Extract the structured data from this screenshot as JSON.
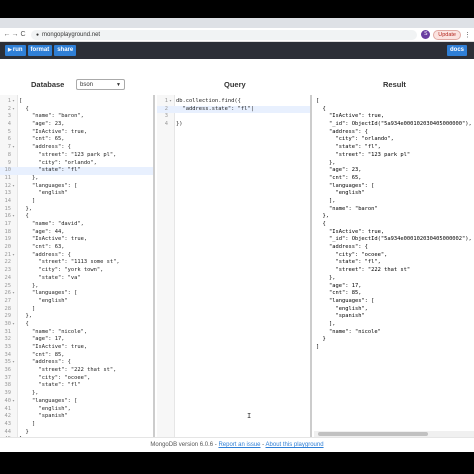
{
  "browser": {
    "url": "mongoplayground.net",
    "avatar_letter": "S",
    "update_label": "Update",
    "back_icon": "←",
    "forward_icon": "→",
    "reload_icon": "C",
    "menu_icon": "⋮"
  },
  "toolbar": {
    "run_label": "run",
    "format_label": "format",
    "share_label": "share",
    "docs_label": "docs"
  },
  "columns": {
    "database": "Database",
    "query": "Query",
    "result": "Result",
    "db_mode": "bson"
  },
  "database_lines": [
    {
      "n": "1",
      "f": "▾",
      "t": "["
    },
    {
      "n": "2",
      "f": "▾",
      "t": "  {"
    },
    {
      "n": "3",
      "f": "",
      "t": "    \"name\": \"baron\","
    },
    {
      "n": "4",
      "f": "",
      "t": "    \"age\": 23,"
    },
    {
      "n": "5",
      "f": "",
      "t": "    \"IsActive\": true,"
    },
    {
      "n": "6",
      "f": "",
      "t": "    \"cnt\": 65,"
    },
    {
      "n": "7",
      "f": "▾",
      "t": "    \"address\": {"
    },
    {
      "n": "8",
      "f": "",
      "t": "      \"street\": \"123 park pl\","
    },
    {
      "n": "9",
      "f": "",
      "t": "      \"city\": \"orlando\","
    },
    {
      "n": "10",
      "f": "",
      "t": "      \"state\": \"fl\""
    },
    {
      "n": "11",
      "f": "",
      "t": "    },"
    },
    {
      "n": "12",
      "f": "▾",
      "t": "    \"languages\": ["
    },
    {
      "n": "13",
      "f": "",
      "t": "      \"english\""
    },
    {
      "n": "14",
      "f": "",
      "t": "    ]"
    },
    {
      "n": "15",
      "f": "",
      "t": "  },"
    },
    {
      "n": "16",
      "f": "▾",
      "t": "  {"
    },
    {
      "n": "17",
      "f": "",
      "t": "    \"name\": \"david\","
    },
    {
      "n": "18",
      "f": "",
      "t": "    \"age\": 44,"
    },
    {
      "n": "19",
      "f": "",
      "t": "    \"IsActive\": true,"
    },
    {
      "n": "20",
      "f": "",
      "t": "    \"cnt\": 63,"
    },
    {
      "n": "21",
      "f": "▾",
      "t": "    \"address\": {"
    },
    {
      "n": "22",
      "f": "",
      "t": "      \"street\": \"1113 some st\","
    },
    {
      "n": "23",
      "f": "",
      "t": "      \"city\": \"york town\","
    },
    {
      "n": "24",
      "f": "",
      "t": "      \"state\": \"va\""
    },
    {
      "n": "25",
      "f": "",
      "t": "    },"
    },
    {
      "n": "26",
      "f": "▾",
      "t": "    \"languages\": ["
    },
    {
      "n": "27",
      "f": "",
      "t": "      \"english\""
    },
    {
      "n": "28",
      "f": "",
      "t": "    ]"
    },
    {
      "n": "29",
      "f": "",
      "t": "  },"
    },
    {
      "n": "30",
      "f": "▾",
      "t": "  {"
    },
    {
      "n": "31",
      "f": "",
      "t": "    \"name\": \"nicole\","
    },
    {
      "n": "32",
      "f": "",
      "t": "    \"age\": 17,"
    },
    {
      "n": "33",
      "f": "",
      "t": "    \"IsActive\": true,"
    },
    {
      "n": "34",
      "f": "",
      "t": "    \"cnt\": 85,"
    },
    {
      "n": "35",
      "f": "▾",
      "t": "    \"address\": {"
    },
    {
      "n": "36",
      "f": "",
      "t": "      \"street\": \"222 that st\","
    },
    {
      "n": "37",
      "f": "",
      "t": "      \"city\": \"ocoee\","
    },
    {
      "n": "38",
      "f": "",
      "t": "      \"state\": \"fl\""
    },
    {
      "n": "39",
      "f": "",
      "t": "    },"
    },
    {
      "n": "40",
      "f": "▾",
      "t": "    \"languages\": ["
    },
    {
      "n": "41",
      "f": "",
      "t": "      \"english\","
    },
    {
      "n": "42",
      "f": "",
      "t": "      \"spanish\""
    },
    {
      "n": "43",
      "f": "",
      "t": "    ]"
    },
    {
      "n": "44",
      "f": "",
      "t": "  }"
    },
    {
      "n": "45",
      "f": "",
      "t": "]"
    }
  ],
  "query_lines": [
    {
      "n": "1",
      "f": "▾",
      "t": "db.collection.find({"
    },
    {
      "n": "2",
      "f": "",
      "t": "  \"address.state\": \"fl\"|"
    },
    {
      "n": "3",
      "f": "",
      "t": ""
    },
    {
      "n": "4",
      "f": "",
      "t": "})"
    }
  ],
  "result_lines": [
    "[",
    "  {",
    "    \"IsActive\": true,",
    "    \"_id\": ObjectId(\"5a934e000102030405000000\"),",
    "    \"address\": {",
    "      \"city\": \"orlando\",",
    "      \"state\": \"fl\",",
    "      \"street\": \"123 park pl\"",
    "    },",
    "    \"age\": 23,",
    "    \"cnt\": 65,",
    "    \"languages\": [",
    "      \"english\"",
    "    ],",
    "    \"name\": \"baron\"",
    "  },",
    "  {",
    "    \"IsActive\": true,",
    "    \"_id\": ObjectId(\"5a934e000102030405000002\"),",
    "    \"address\": {",
    "      \"city\": \"ocoee\",",
    "      \"state\": \"fl\",",
    "      \"street\": \"222 that st\"",
    "    },",
    "    \"age\": 17,",
    "    \"cnt\": 85,",
    "    \"languages\": [",
    "      \"english\",",
    "      \"spanish\"",
    "    ],",
    "    \"name\": \"nicole\"",
    "  }",
    "]"
  ],
  "footer": {
    "version": "MongoDB version 6.0.6 -",
    "report_link": "Report an issue",
    "separator": "-",
    "about_link": "About this playground"
  }
}
